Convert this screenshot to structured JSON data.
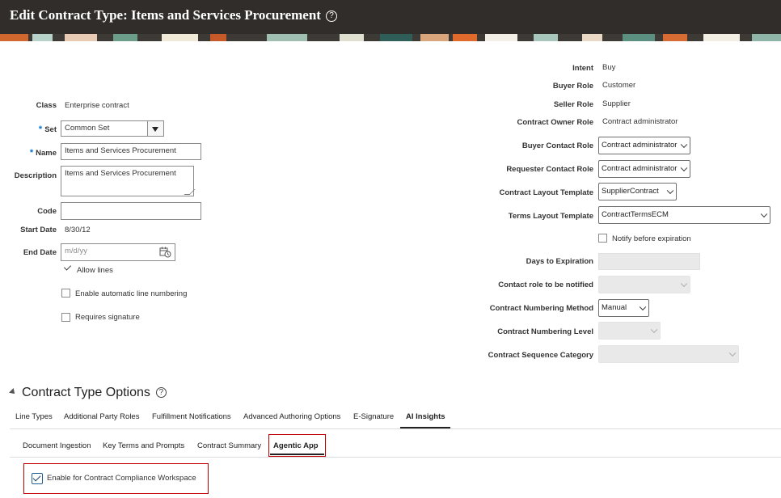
{
  "header": {
    "title": "Edit Contract Type: Items and Services Procurement",
    "help_glyph": "?"
  },
  "left_form": {
    "class": {
      "label": "Class",
      "value": "Enterprise contract"
    },
    "set": {
      "label": "Set",
      "required_mark": "*",
      "value": "Common Set"
    },
    "name": {
      "label": "Name",
      "required_mark": "*",
      "value": "Items and Services Procurement"
    },
    "description": {
      "label": "Description",
      "value": "Items and Services Procurement"
    },
    "code": {
      "label": "Code",
      "value": ""
    },
    "start_date": {
      "label": "Start Date",
      "value": "8/30/12"
    },
    "end_date": {
      "label": "End Date",
      "placeholder": "m/d/yy"
    },
    "allow_lines": {
      "label": "Allow lines",
      "checked": true
    },
    "auto_line_numbering": {
      "label": "Enable automatic line numbering",
      "checked": false
    },
    "requires_signature": {
      "label": "Requires signature",
      "checked": false
    }
  },
  "right_form": {
    "intent": {
      "label": "Intent",
      "value": "Buy"
    },
    "buyer_role": {
      "label": "Buyer Role",
      "value": "Customer"
    },
    "seller_role": {
      "label": "Seller Role",
      "value": "Supplier"
    },
    "contract_owner_role": {
      "label": "Contract Owner Role",
      "value": "Contract administrator"
    },
    "buyer_contact_role": {
      "label": "Buyer Contact Role",
      "value": "Contract administrator"
    },
    "requester_contact_role": {
      "label": "Requester Contact Role",
      "value": "Contract administrator"
    },
    "contract_layout_template": {
      "label": "Contract Layout Template",
      "value": "SupplierContract"
    },
    "terms_layout_template": {
      "label": "Terms Layout Template",
      "value": "ContractTermsECM"
    },
    "notify_before_expiration": {
      "label": "Notify before expiration",
      "checked": false
    },
    "days_to_expiration": {
      "label": "Days to Expiration",
      "value": ""
    },
    "contact_role_notified": {
      "label": "Contact role to be notified",
      "value": ""
    },
    "numbering_method": {
      "label": "Contract Numbering Method",
      "value": "Manual"
    },
    "numbering_level": {
      "label": "Contract Numbering Level",
      "value": ""
    },
    "sequence_category": {
      "label": "Contract Sequence Category",
      "value": ""
    }
  },
  "options": {
    "title": "Contract Type Options",
    "tabs": [
      "Line Types",
      "Additional Party Roles",
      "Fulfillment Notifications",
      "Advanced Authoring Options",
      "E-Signature",
      "AI Insights"
    ],
    "active_tab": "AI Insights",
    "subtabs": [
      "Document Ingestion",
      "Key Terms and Prompts",
      "Contract Summary",
      "Agentic App"
    ],
    "active_subtab": "Agentic App",
    "compliance_workspace": {
      "label": "Enable for Contract Compliance Workspace",
      "checked": true
    }
  },
  "colors": {
    "header_bg": "#312d2a",
    "required": "#0572ce",
    "highlight_border": "#c00000"
  }
}
